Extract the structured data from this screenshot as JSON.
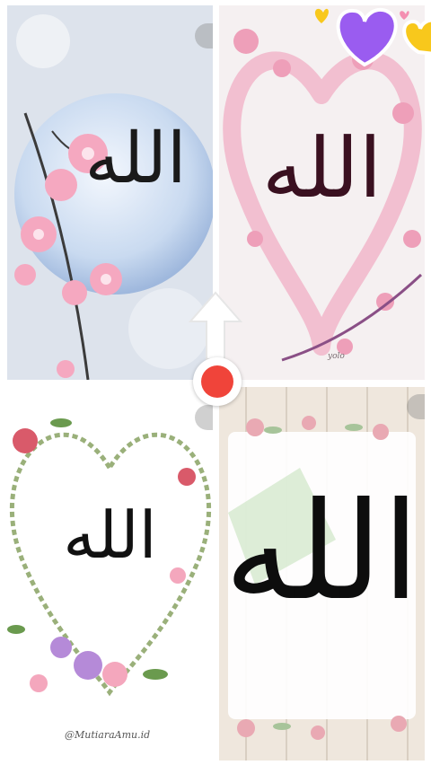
{
  "images": [
    {
      "id": "tl",
      "calligraphy": "الله"
    },
    {
      "id": "tr",
      "calligraphy": "الله",
      "watermark": "yolo"
    },
    {
      "id": "bl",
      "calligraphy": "الله",
      "watermark": "@MutiaraAmu.id"
    },
    {
      "id": "br",
      "calligraphy": "الله"
    }
  ],
  "colors": {
    "record": "#f0443a",
    "heart_purple": "#9a5cf0",
    "heart_yellow": "#f8c81c",
    "heart_pink": "#f48fb1"
  },
  "icons": {
    "swipe": "arrow-up-icon",
    "record": "record-icon",
    "stickers": "hearts-icon"
  }
}
